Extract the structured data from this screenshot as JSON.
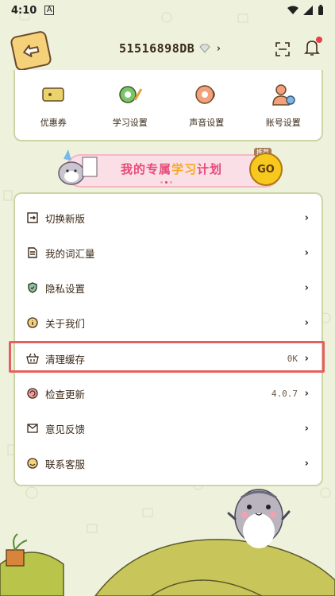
{
  "status_bar": {
    "time": "4:10",
    "app_badge": "A"
  },
  "header": {
    "user_id": "51516898DB"
  },
  "shortcuts": [
    {
      "label": "优惠券",
      "icon": "coupon-icon"
    },
    {
      "label": "学习设置",
      "icon": "study-settings-icon"
    },
    {
      "label": "声音设置",
      "icon": "sound-settings-icon"
    },
    {
      "label": "账号设置",
      "icon": "account-settings-icon"
    }
  ],
  "banner": {
    "title_pink": "我的专属",
    "title_orange": "学习",
    "title_end": "计划",
    "go": "GO",
    "tag": "推荐"
  },
  "menu": [
    {
      "label": "切换新版",
      "value": "",
      "icon": "switch-version-icon"
    },
    {
      "label": "我的词汇量",
      "value": "",
      "icon": "vocabulary-icon"
    },
    {
      "label": "隐私设置",
      "value": "",
      "icon": "privacy-shield-icon"
    },
    {
      "label": "关于我们",
      "value": "",
      "icon": "info-icon"
    },
    {
      "label": "清理缓存",
      "value": "0K",
      "icon": "basket-icon"
    },
    {
      "label": "检查更新",
      "value": "4.0.7",
      "icon": "update-icon"
    },
    {
      "label": "意见反馈",
      "value": "",
      "icon": "mail-icon"
    },
    {
      "label": "联系客服",
      "value": "",
      "icon": "customer-service-icon"
    }
  ],
  "colors": {
    "background": "#eef2dc",
    "card_border": "#cbd6a6",
    "highlight": "#e36060",
    "banner_pink": "#e84a78"
  }
}
